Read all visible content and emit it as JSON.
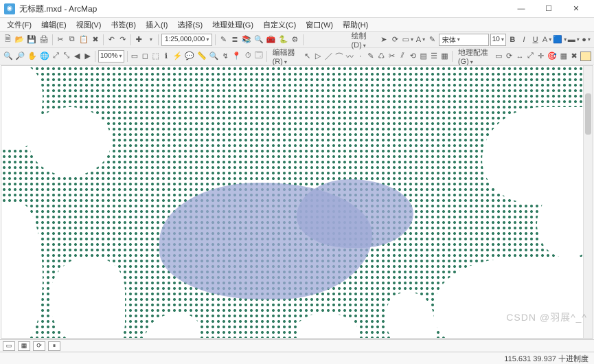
{
  "window": {
    "title": "无标题.mxd - ArcMap"
  },
  "menu": {
    "file": "文件(F)",
    "edit": "编辑(E)",
    "view": "视图(V)",
    "bookmarks": "书签(B)",
    "insert": "插入(I)",
    "select": "选择(S)",
    "geoproc": "地理处理(G)",
    "custom": "自定义(C)",
    "window": "窗口(W)",
    "help": "帮助(H)"
  },
  "toolbar1": {
    "scale": "1:25,000,000",
    "zoom": "100%",
    "editor_label": "编辑器(R)",
    "draw_label": "绘制(D)",
    "font_name": "宋体",
    "font_size": "10",
    "georef_label": "地理配准(G)"
  },
  "icons": {
    "new": "🗎",
    "open": "📂",
    "save": "💾",
    "print": "🖨",
    "cut": "✂",
    "copy": "⧉",
    "paste": "📋",
    "undo": "↶",
    "redo": "↷",
    "add": "✚",
    "zoomin": "🔍",
    "zoomout": "🔎",
    "pan": "✋",
    "full": "🌐",
    "fixedin": "⤢",
    "fixedout": "⤡",
    "prev": "◀",
    "next": "▶",
    "select": "▭",
    "clear": "◻",
    "identify": "ℹ",
    "find": "🔍",
    "measure": "📏",
    "goto": "📍",
    "catalog": "📚",
    "toc": "≣",
    "python": "🐍",
    "model": "⚙",
    "tbx": "🧰",
    "arrow": "➤",
    "rect": "▭",
    "text": "A",
    "b": "B",
    "i": "I",
    "u": "U",
    "color": "A",
    "chev": "▾"
  },
  "status": {
    "coords": "115.631  39.937 十进制度"
  },
  "watermark": "CSDN @羽展^_^"
}
